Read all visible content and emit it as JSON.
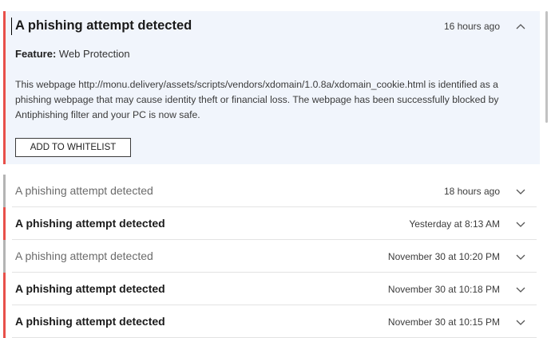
{
  "notifications": [
    {
      "title": "A phishing attempt detected",
      "time": "16 hours ago",
      "expanded": true,
      "read": false,
      "chevron": "chevron-up-icon",
      "feature_label": "Feature:",
      "feature_value": "Web Protection",
      "description": "This webpage http://monu.delivery/assets/scripts/vendors/xdomain/1.0.8a/xdomain_cookie.html is identified as a phishing webpage that may cause identity theft or financial loss. The webpage has been successfully blocked by Antiphishing filter and your PC is now safe.",
      "action_label": "ADD TO WHITELIST"
    },
    {
      "title": "A phishing attempt detected",
      "time": "18 hours ago",
      "expanded": false,
      "read": true,
      "chevron": "chevron-down-icon"
    },
    {
      "title": "A phishing attempt detected",
      "time": "Yesterday at 8:13 AM",
      "expanded": false,
      "read": false,
      "chevron": "chevron-down-icon"
    },
    {
      "title": "A phishing attempt detected",
      "time": "November 30 at 10:20 PM",
      "expanded": false,
      "read": true,
      "chevron": "chevron-down-icon"
    },
    {
      "title": "A phishing attempt detected",
      "time": "November 30 at 10:18 PM",
      "expanded": false,
      "read": false,
      "chevron": "chevron-down-icon"
    },
    {
      "title": "A phishing attempt detected",
      "time": "November 30 at 10:15 PM",
      "expanded": false,
      "read": false,
      "chevron": "chevron-down-icon"
    }
  ],
  "colors": {
    "unread_accent": "#e8504a",
    "read_accent": "#b4b4b4",
    "expanded_background": "#f1f5fc"
  }
}
